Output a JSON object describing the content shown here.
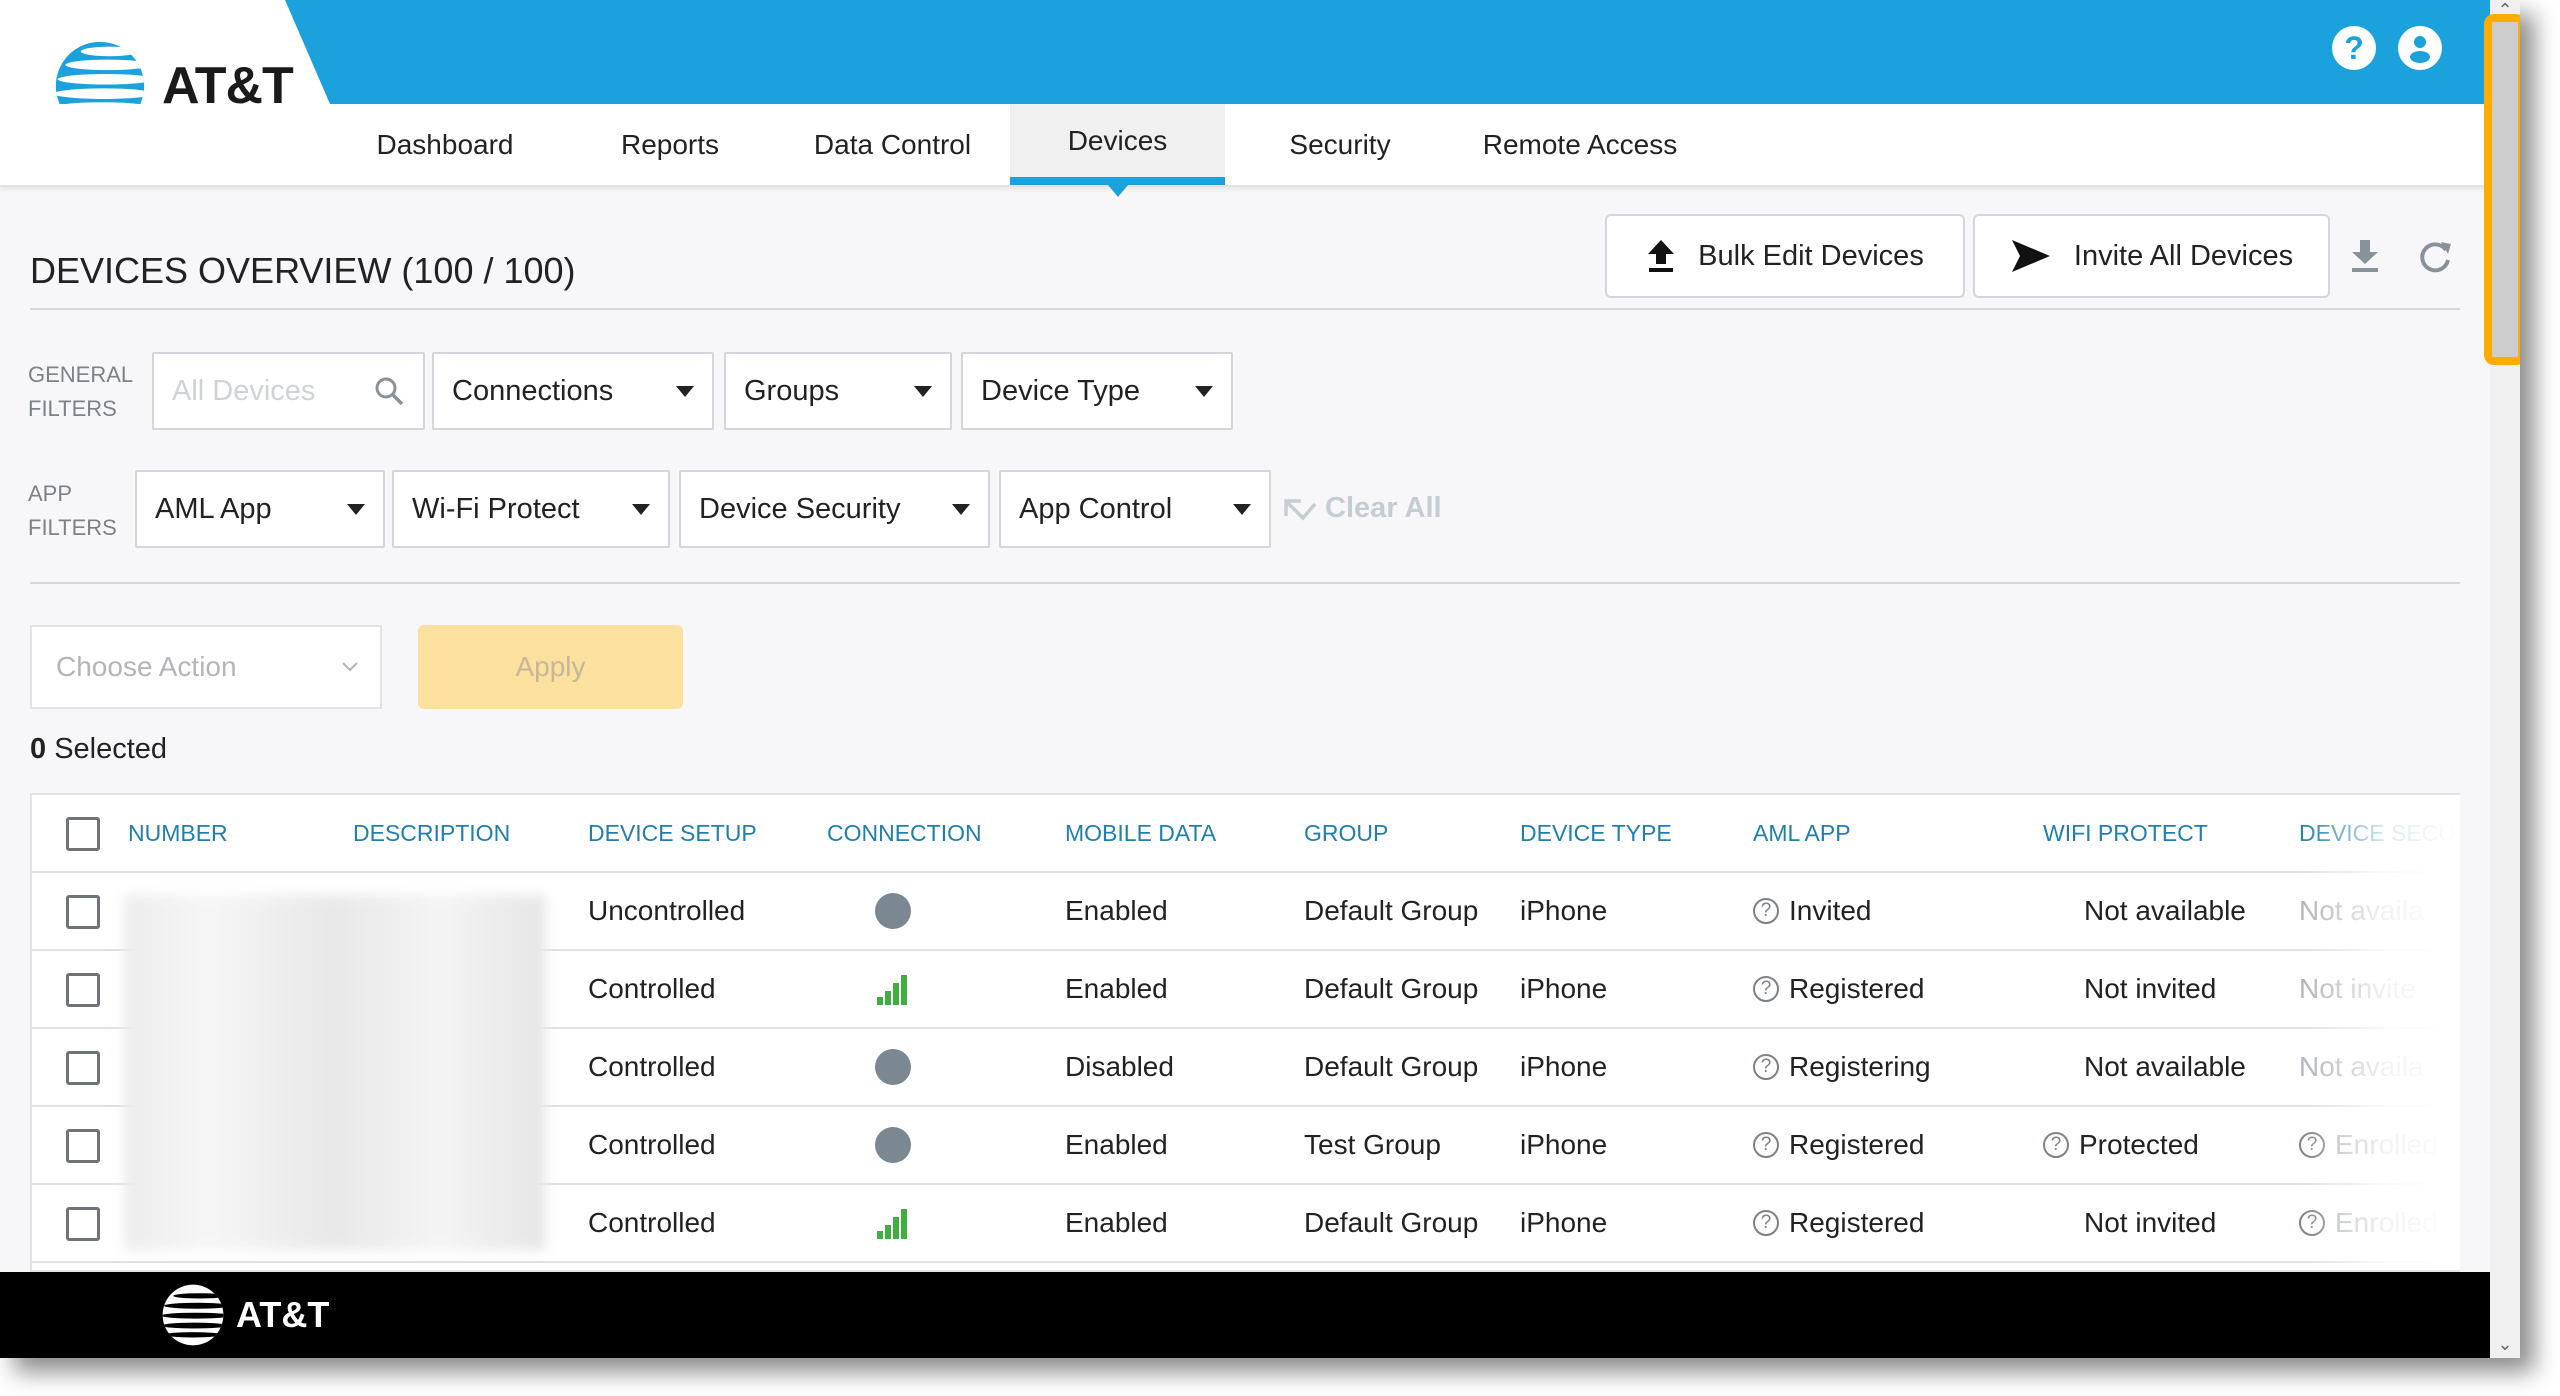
{
  "brand": {
    "name": "AT&T",
    "accent": "#1ba1dc",
    "footer_name": "AT&T"
  },
  "header": {
    "icons": [
      "help-icon",
      "user-account-icon"
    ],
    "help_glyph": "?"
  },
  "nav": {
    "tabs": [
      {
        "label": "Dashboard",
        "active": false
      },
      {
        "label": "Reports",
        "active": false
      },
      {
        "label": "Data Control",
        "active": false
      },
      {
        "label": "Devices",
        "active": true
      },
      {
        "label": "Security",
        "active": false
      },
      {
        "label": "Remote Access",
        "active": false
      }
    ]
  },
  "page": {
    "title": "DEVICES OVERVIEW (100 / 100)",
    "bulk_edit_label": "Bulk Edit Devices",
    "invite_all_label": "Invite All Devices",
    "tool_icons": [
      "download-icon",
      "refresh-icon"
    ]
  },
  "filters": {
    "general_label_line1": "GENERAL",
    "general_label_line2": "FILTERS",
    "search_placeholder": "All Devices",
    "general": [
      "Connections",
      "Groups",
      "Device Type"
    ],
    "app_label_line1": "APP",
    "app_label_line2": "FILTERS",
    "app": [
      "AML App",
      "Wi-Fi Protect",
      "Device Security",
      "App Control"
    ],
    "clear_all": "Clear All"
  },
  "actions": {
    "choose_placeholder": "Choose Action",
    "apply_label": "Apply",
    "apply_color": "#fbe09e",
    "selected_count": "0",
    "selected_label": "Selected"
  },
  "table": {
    "columns": [
      "NUMBER",
      "DESCRIPTION",
      "DEVICE SETUP",
      "CONNECTION",
      "MOBILE DATA",
      "GROUP",
      "DEVICE TYPE",
      "AML APP",
      "WIFI PROTECT",
      "DEVICE SECURI"
    ],
    "rows": [
      {
        "setup": "Uncontrolled",
        "connection": "offline",
        "mobile_data": "Enabled",
        "group": "Default Group",
        "device_type": "iPhone",
        "aml_app": "Invited",
        "aml_help": true,
        "wifi_protect": "Not available",
        "wifi_help": false,
        "device_security": "Not availa",
        "sec_help": false
      },
      {
        "setup": "Controlled",
        "connection": "signal",
        "mobile_data": "Enabled",
        "group": "Default Group",
        "device_type": "iPhone",
        "aml_app": "Registered",
        "aml_help": true,
        "wifi_protect": "Not invited",
        "wifi_help": false,
        "device_security": "Not invite",
        "sec_help": false
      },
      {
        "setup": "Controlled",
        "connection": "offline",
        "mobile_data": "Disabled",
        "group": "Default Group",
        "device_type": "iPhone",
        "aml_app": "Registering",
        "aml_help": true,
        "wifi_protect": "Not available",
        "wifi_help": false,
        "device_security": "Not availa",
        "sec_help": false
      },
      {
        "setup": "Controlled",
        "connection": "offline",
        "mobile_data": "Enabled",
        "group": "Test Group",
        "device_type": "iPhone",
        "aml_app": "Registered",
        "aml_help": true,
        "wifi_protect": "Protected",
        "wifi_help": true,
        "device_security": "Enrolled",
        "sec_help": true
      },
      {
        "setup": "Controlled",
        "connection": "signal",
        "mobile_data": "Enabled",
        "group": "Default Group",
        "device_type": "iPhone",
        "aml_app": "Registered",
        "aml_help": true,
        "wifi_protect": "Not invited",
        "wifi_help": false,
        "device_security": "Enrolled",
        "sec_help": true
      }
    ],
    "status_colors": {
      "offline": "#7b8791",
      "signal": "#3fae3f"
    }
  }
}
